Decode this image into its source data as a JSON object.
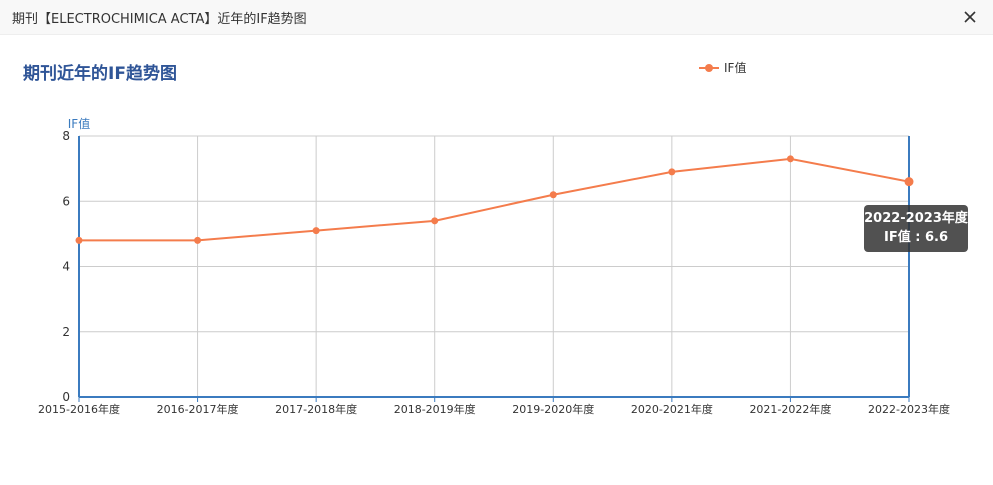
{
  "window": {
    "title": "期刊【ELECTROCHIMICA ACTA】近年的IF趋势图"
  },
  "chart_data": {
    "type": "line",
    "title": "期刊近年的IF趋势图",
    "ylabel": "IF值",
    "xlabel": "",
    "categories": [
      "2015-2016年度",
      "2016-2017年度",
      "2017-2018年度",
      "2018-2019年度",
      "2019-2020年度",
      "2020-2021年度",
      "2021-2022年度",
      "2022-2023年度"
    ],
    "series": [
      {
        "name": "IF值",
        "values": [
          4.8,
          4.8,
          5.1,
          5.4,
          6.2,
          6.9,
          7.3,
          6.6
        ],
        "color": "#f47c4c"
      }
    ],
    "ylim": [
      0,
      8
    ],
    "yticks": [
      "0",
      "2",
      "4",
      "6",
      "8"
    ],
    "grid": true,
    "legend_position": "top-right",
    "axis_color": "#3b7bbf",
    "tooltip": {
      "category": "2022-2023年度",
      "text": "IF值 : 6.6"
    }
  }
}
